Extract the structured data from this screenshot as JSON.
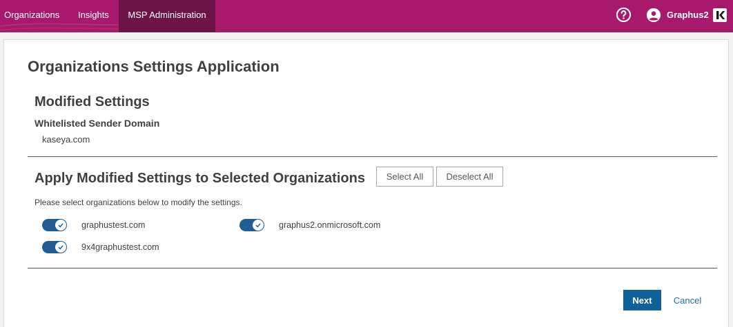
{
  "nav": {
    "items": [
      {
        "label": "Organizations"
      },
      {
        "label": "Insights"
      },
      {
        "label": "MSP Administration"
      }
    ],
    "help_icon": "question-circle-icon",
    "user": {
      "name": "Graphus2",
      "icon": "user-circle-icon"
    },
    "logo": "kaseya-logo-icon"
  },
  "page": {
    "title": "Organizations Settings Application",
    "modified": {
      "heading": "Modified Settings",
      "setting_name": "Whitelisted Sender Domain",
      "setting_value": "kaseya.com"
    },
    "apply": {
      "heading": "Apply Modified Settings to Selected Organizations",
      "select_all": "Select All",
      "deselect_all": "Deselect All",
      "instructions": "Please select organizations below to modify the settings.",
      "organizations": [
        {
          "name": "graphustest.com",
          "enabled": true
        },
        {
          "name": "graphus2.onmicrosoft.com",
          "enabled": true
        },
        {
          "name": "9x4graphustest.com",
          "enabled": true
        }
      ]
    },
    "actions": {
      "next": "Next",
      "cancel": "Cancel"
    }
  },
  "colors": {
    "topbar": "#a8196c",
    "nav_active": "#6d1446",
    "toggle_on": "#1f5d94",
    "primary_button": "#10609a",
    "link": "#1e6aa5"
  }
}
